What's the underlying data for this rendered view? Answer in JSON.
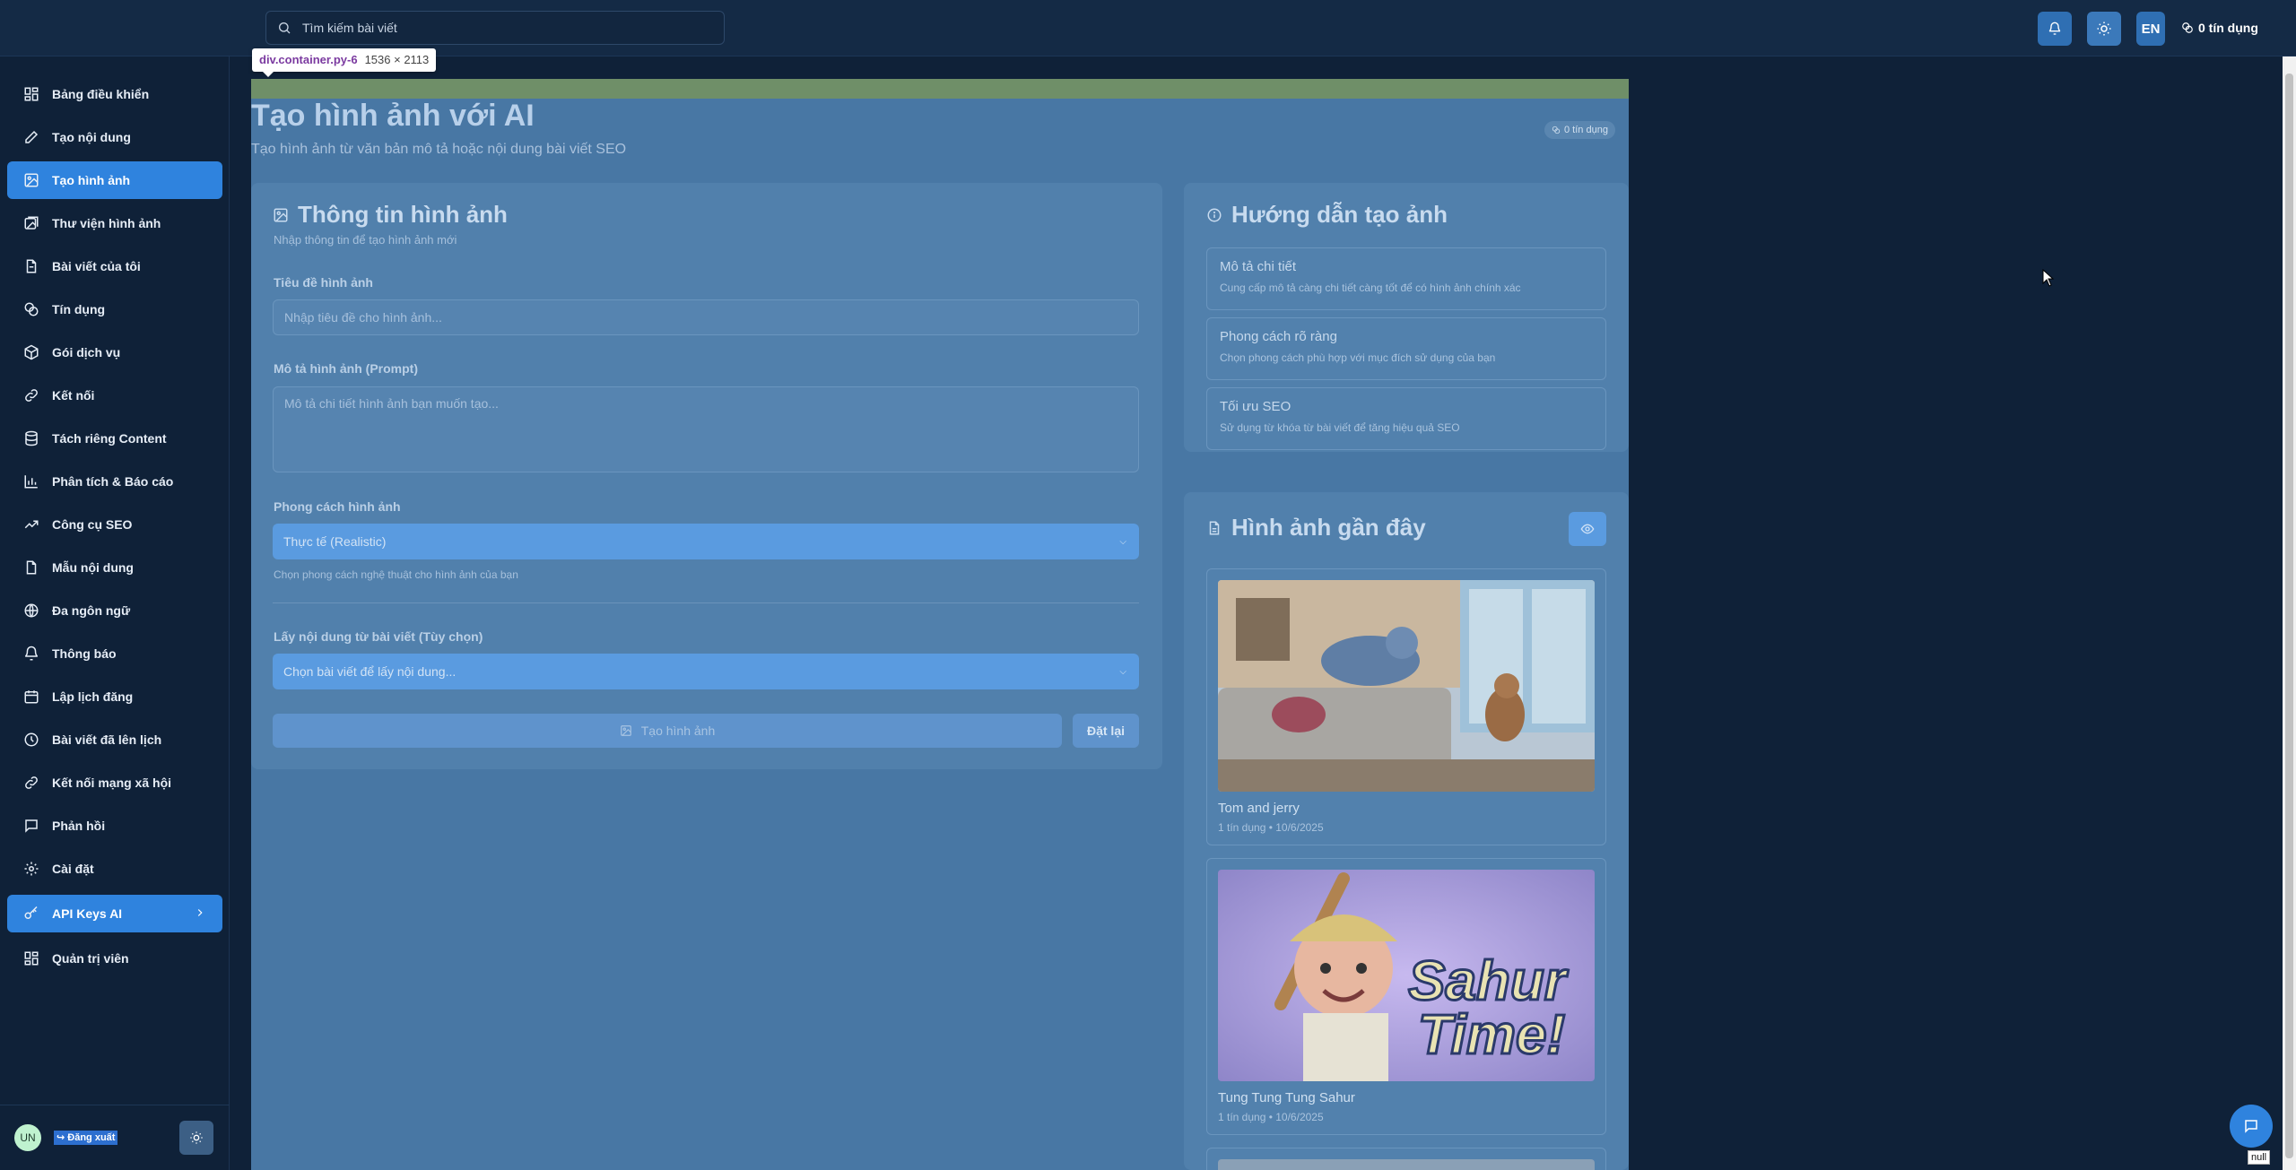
{
  "topbar": {
    "search_placeholder": "Tìm kiếm bài viết",
    "lang": "EN",
    "credits": "0 tín dụng"
  },
  "sidebar": {
    "items": [
      {
        "label": "Bảng điều khiển",
        "icon": "dashboard-icon"
      },
      {
        "label": "Tạo nội dung",
        "icon": "edit-icon"
      },
      {
        "label": "Tạo hình ảnh",
        "icon": "image-icon",
        "active": true
      },
      {
        "label": "Thư viện hình ảnh",
        "icon": "images-icon"
      },
      {
        "label": "Bài viết của tôi",
        "icon": "file-icon"
      },
      {
        "label": "Tín dụng",
        "icon": "coins-icon"
      },
      {
        "label": "Gói dịch vụ",
        "icon": "package-icon"
      },
      {
        "label": "Kết nối",
        "icon": "link-icon"
      },
      {
        "label": "Tách riêng Content",
        "icon": "database-icon"
      },
      {
        "label": "Phân tích & Báo cáo",
        "icon": "bar-chart-icon"
      },
      {
        "label": "Công cụ SEO",
        "icon": "trending-icon"
      },
      {
        "label": "Mẫu nội dung",
        "icon": "template-icon"
      },
      {
        "label": "Đa ngôn ngữ",
        "icon": "globe-icon"
      },
      {
        "label": "Thông báo",
        "icon": "bell-icon"
      },
      {
        "label": "Lập lịch đăng",
        "icon": "calendar-icon"
      },
      {
        "label": "Bài viết đã lên lịch",
        "icon": "clock-icon"
      },
      {
        "label": "Kết nối mạng xã hội",
        "icon": "share-icon"
      },
      {
        "label": "Phản hồi",
        "icon": "message-icon"
      },
      {
        "label": "Cài đặt",
        "icon": "gear-icon"
      },
      {
        "label": "API Keys AI",
        "icon": "key-icon",
        "active": true
      },
      {
        "label": "Quản trị viên",
        "icon": "admin-icon"
      }
    ],
    "avatar": "UN",
    "logout": "Đăng xuất"
  },
  "tooltip": {
    "selector": "div.container.py-6",
    "size": "1536 × 2113"
  },
  "page": {
    "title": "Tạo hình ảnh với AI",
    "subtitle": "Tạo hình ảnh từ văn bản mô tả hoặc nội dung bài viết SEO",
    "credits": "0 tín dụng"
  },
  "form": {
    "title": "Thông tin hình ảnh",
    "subtitle": "Nhập thông tin để tạo hình ảnh mới",
    "title_label": "Tiêu đề hình ảnh",
    "title_placeholder": "Nhập tiêu đề cho hình ảnh...",
    "prompt_label": "Mô tả hình ảnh (Prompt)",
    "prompt_placeholder": "Mô tả chi tiết hình ảnh bạn muốn tạo...",
    "style_label": "Phong cách hình ảnh",
    "style_value": "Thực tế (Realistic)",
    "style_hint": "Chọn phong cách nghệ thuật cho hình ảnh của bạn",
    "post_label": "Lấy nội dung từ bài viết (Tùy chọn)",
    "post_placeholder": "Chọn bài viết để lấy nội dung...",
    "generate": "Tạo hình ảnh",
    "reset": "Đặt lại"
  },
  "guide": {
    "title": "Hướng dẫn tạo ảnh",
    "tips": [
      {
        "title": "Mô tả chi tiết",
        "desc": "Cung cấp mô tả càng chi tiết càng tốt để có hình ảnh chính xác"
      },
      {
        "title": "Phong cách rõ ràng",
        "desc": "Chọn phong cách phù hợp với mục đích sử dụng của bạn"
      },
      {
        "title": "Tối ưu SEO",
        "desc": "Sử dụng từ khóa từ bài viết để tăng hiệu quả SEO"
      }
    ]
  },
  "recent": {
    "title": "Hình ảnh gần đây",
    "images": [
      {
        "title": "Tom and jerry",
        "meta": "1 tín dụng • 10/6/2025"
      },
      {
        "title": "Tung Tung Tung Sahur",
        "meta": "1 tín dụng • 10/6/2025",
        "art_text_1": "Sahur",
        "art_text_2": "Time!"
      }
    ]
  },
  "misc": {
    "null_label": "null"
  }
}
